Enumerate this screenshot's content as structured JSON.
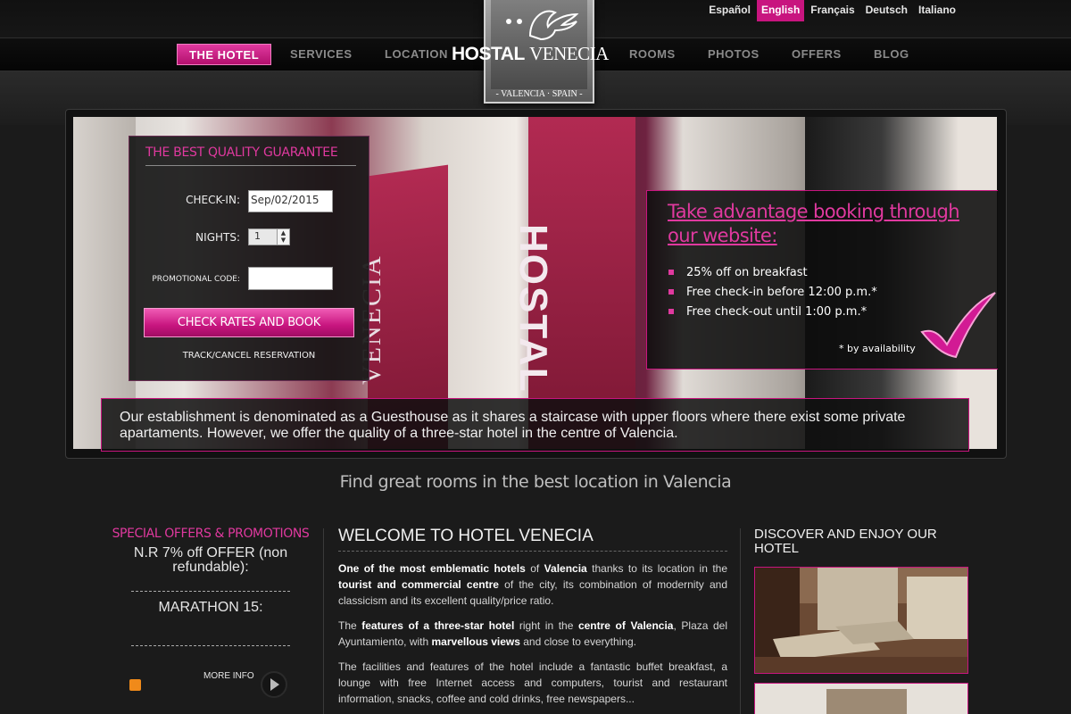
{
  "languages": [
    "Español",
    "English",
    "Français",
    "Deutsch",
    "Italiano"
  ],
  "nav": {
    "items": [
      "THE HOTEL",
      "SERVICES",
      "LOCATION",
      "ROOMS",
      "PHOTOS",
      "OFFERS",
      "BLOG"
    ]
  },
  "logo": {
    "word1": "HOSTAL",
    "word2": "VENECIA",
    "subtitle": "- VALENCIA · SPAIN -"
  },
  "booking": {
    "title": "THE BEST QUALITY GUARANTEE",
    "checkin_label": "CHECK-IN:",
    "checkin_value": "Sep/02/2015",
    "nights_label": "NIGHTS:",
    "nights_value": "1",
    "promo_label": "PROMOTIONAL CODE:",
    "promo_value": "",
    "button_label": "CHECK RATES AND BOOK",
    "track_label": "TRACK/CANCEL RESERVATION"
  },
  "promo": {
    "title": "Take advantage booking through our website:",
    "items": [
      "25% off on breakfast",
      "Free check-in before 12:00 p.m.*",
      "Free check-out until 1:00 p.m.*"
    ],
    "note": "* by availability"
  },
  "hero": {
    "caption": "Our establishment is denominated as a Guesthouse as it shares a staircase with upper floors where there exist some private apartaments. However, we offer the quality of a three-star hotel in the centre of Valencia.",
    "banner_text": "HOSTAL",
    "banner_text_2": "VENECIA"
  },
  "tagline": "Find great rooms in the best location in Valencia",
  "offers": {
    "title": "SPECIAL OFFERS & PROMOTIONS",
    "items": [
      "N.R 7% off OFFER (non refundable):",
      "MARATHON 15:"
    ],
    "more_info": "MORE INFO"
  },
  "welcome": {
    "title": "WELCOME TO HOTEL VENECIA",
    "p1": {
      "a": "One of the most emblematic hotels",
      "b": " of ",
      "c": "Valencia",
      "d": " thanks to its location in the ",
      "e": "tourist and commercial centre",
      "f": " of the city, its combination of modernity and classicism and its excellent quality/price ratio."
    },
    "p2": {
      "a": "The ",
      "b": "features of a three-star hotel",
      "c": " right in the ",
      "d": "centre of Valencia",
      "e": ", Plaza del Ayuntamiento, with ",
      "f": "marvellous views",
      "g": " and close to everything."
    },
    "p3": "The facilities and features of the hotel include a fantastic buffet breakfast, a lounge with free Internet access and computers, tourist and restaurant information, snacks, coffee and cold drinks, free newspapers..."
  },
  "discover": {
    "title": "DISCOVER AND ENJOY OUR HOTEL"
  },
  "colors": {
    "accent": "#c8157f",
    "accent_light": "#e0399f",
    "background": "#1b1b1b"
  }
}
